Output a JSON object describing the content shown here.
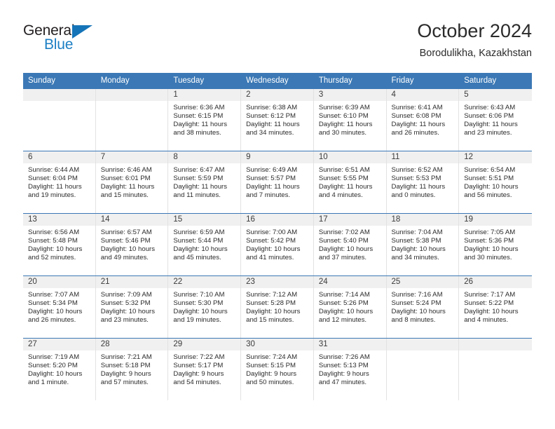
{
  "brand": {
    "name_part1": "General",
    "name_part2": "Blue",
    "triangle_color": "#1574b8",
    "blue_text_color": "#1c7fc4"
  },
  "header": {
    "title": "October 2024",
    "subtitle": "Borodulikha, Kazakhstan"
  },
  "theme": {
    "header_blue": "#3b78b5",
    "daynum_band": "#f0f0f0",
    "cell_border": "#e2e2e2",
    "text": "#2b2b2b"
  },
  "weekday_headers": [
    "Sunday",
    "Monday",
    "Tuesday",
    "Wednesday",
    "Thursday",
    "Friday",
    "Saturday"
  ],
  "weeks": [
    [
      {
        "day": "",
        "sunrise": "",
        "sunset": "",
        "daylight_1": "",
        "daylight_2": ""
      },
      {
        "day": "",
        "sunrise": "",
        "sunset": "",
        "daylight_1": "",
        "daylight_2": ""
      },
      {
        "day": "1",
        "sunrise": "Sunrise: 6:36 AM",
        "sunset": "Sunset: 6:15 PM",
        "daylight_1": "Daylight: 11 hours",
        "daylight_2": "and 38 minutes."
      },
      {
        "day": "2",
        "sunrise": "Sunrise: 6:38 AM",
        "sunset": "Sunset: 6:12 PM",
        "daylight_1": "Daylight: 11 hours",
        "daylight_2": "and 34 minutes."
      },
      {
        "day": "3",
        "sunrise": "Sunrise: 6:39 AM",
        "sunset": "Sunset: 6:10 PM",
        "daylight_1": "Daylight: 11 hours",
        "daylight_2": "and 30 minutes."
      },
      {
        "day": "4",
        "sunrise": "Sunrise: 6:41 AM",
        "sunset": "Sunset: 6:08 PM",
        "daylight_1": "Daylight: 11 hours",
        "daylight_2": "and 26 minutes."
      },
      {
        "day": "5",
        "sunrise": "Sunrise: 6:43 AM",
        "sunset": "Sunset: 6:06 PM",
        "daylight_1": "Daylight: 11 hours",
        "daylight_2": "and 23 minutes."
      }
    ],
    [
      {
        "day": "6",
        "sunrise": "Sunrise: 6:44 AM",
        "sunset": "Sunset: 6:04 PM",
        "daylight_1": "Daylight: 11 hours",
        "daylight_2": "and 19 minutes."
      },
      {
        "day": "7",
        "sunrise": "Sunrise: 6:46 AM",
        "sunset": "Sunset: 6:01 PM",
        "daylight_1": "Daylight: 11 hours",
        "daylight_2": "and 15 minutes."
      },
      {
        "day": "8",
        "sunrise": "Sunrise: 6:47 AM",
        "sunset": "Sunset: 5:59 PM",
        "daylight_1": "Daylight: 11 hours",
        "daylight_2": "and 11 minutes."
      },
      {
        "day": "9",
        "sunrise": "Sunrise: 6:49 AM",
        "sunset": "Sunset: 5:57 PM",
        "daylight_1": "Daylight: 11 hours",
        "daylight_2": "and 7 minutes."
      },
      {
        "day": "10",
        "sunrise": "Sunrise: 6:51 AM",
        "sunset": "Sunset: 5:55 PM",
        "daylight_1": "Daylight: 11 hours",
        "daylight_2": "and 4 minutes."
      },
      {
        "day": "11",
        "sunrise": "Sunrise: 6:52 AM",
        "sunset": "Sunset: 5:53 PM",
        "daylight_1": "Daylight: 11 hours",
        "daylight_2": "and 0 minutes."
      },
      {
        "day": "12",
        "sunrise": "Sunrise: 6:54 AM",
        "sunset": "Sunset: 5:51 PM",
        "daylight_1": "Daylight: 10 hours",
        "daylight_2": "and 56 minutes."
      }
    ],
    [
      {
        "day": "13",
        "sunrise": "Sunrise: 6:56 AM",
        "sunset": "Sunset: 5:48 PM",
        "daylight_1": "Daylight: 10 hours",
        "daylight_2": "and 52 minutes."
      },
      {
        "day": "14",
        "sunrise": "Sunrise: 6:57 AM",
        "sunset": "Sunset: 5:46 PM",
        "daylight_1": "Daylight: 10 hours",
        "daylight_2": "and 49 minutes."
      },
      {
        "day": "15",
        "sunrise": "Sunrise: 6:59 AM",
        "sunset": "Sunset: 5:44 PM",
        "daylight_1": "Daylight: 10 hours",
        "daylight_2": "and 45 minutes."
      },
      {
        "day": "16",
        "sunrise": "Sunrise: 7:00 AM",
        "sunset": "Sunset: 5:42 PM",
        "daylight_1": "Daylight: 10 hours",
        "daylight_2": "and 41 minutes."
      },
      {
        "day": "17",
        "sunrise": "Sunrise: 7:02 AM",
        "sunset": "Sunset: 5:40 PM",
        "daylight_1": "Daylight: 10 hours",
        "daylight_2": "and 37 minutes."
      },
      {
        "day": "18",
        "sunrise": "Sunrise: 7:04 AM",
        "sunset": "Sunset: 5:38 PM",
        "daylight_1": "Daylight: 10 hours",
        "daylight_2": "and 34 minutes."
      },
      {
        "day": "19",
        "sunrise": "Sunrise: 7:05 AM",
        "sunset": "Sunset: 5:36 PM",
        "daylight_1": "Daylight: 10 hours",
        "daylight_2": "and 30 minutes."
      }
    ],
    [
      {
        "day": "20",
        "sunrise": "Sunrise: 7:07 AM",
        "sunset": "Sunset: 5:34 PM",
        "daylight_1": "Daylight: 10 hours",
        "daylight_2": "and 26 minutes."
      },
      {
        "day": "21",
        "sunrise": "Sunrise: 7:09 AM",
        "sunset": "Sunset: 5:32 PM",
        "daylight_1": "Daylight: 10 hours",
        "daylight_2": "and 23 minutes."
      },
      {
        "day": "22",
        "sunrise": "Sunrise: 7:10 AM",
        "sunset": "Sunset: 5:30 PM",
        "daylight_1": "Daylight: 10 hours",
        "daylight_2": "and 19 minutes."
      },
      {
        "day": "23",
        "sunrise": "Sunrise: 7:12 AM",
        "sunset": "Sunset: 5:28 PM",
        "daylight_1": "Daylight: 10 hours",
        "daylight_2": "and 15 minutes."
      },
      {
        "day": "24",
        "sunrise": "Sunrise: 7:14 AM",
        "sunset": "Sunset: 5:26 PM",
        "daylight_1": "Daylight: 10 hours",
        "daylight_2": "and 12 minutes."
      },
      {
        "day": "25",
        "sunrise": "Sunrise: 7:16 AM",
        "sunset": "Sunset: 5:24 PM",
        "daylight_1": "Daylight: 10 hours",
        "daylight_2": "and 8 minutes."
      },
      {
        "day": "26",
        "sunrise": "Sunrise: 7:17 AM",
        "sunset": "Sunset: 5:22 PM",
        "daylight_1": "Daylight: 10 hours",
        "daylight_2": "and 4 minutes."
      }
    ],
    [
      {
        "day": "27",
        "sunrise": "Sunrise: 7:19 AM",
        "sunset": "Sunset: 5:20 PM",
        "daylight_1": "Daylight: 10 hours",
        "daylight_2": "and 1 minute."
      },
      {
        "day": "28",
        "sunrise": "Sunrise: 7:21 AM",
        "sunset": "Sunset: 5:18 PM",
        "daylight_1": "Daylight: 9 hours",
        "daylight_2": "and 57 minutes."
      },
      {
        "day": "29",
        "sunrise": "Sunrise: 7:22 AM",
        "sunset": "Sunset: 5:17 PM",
        "daylight_1": "Daylight: 9 hours",
        "daylight_2": "and 54 minutes."
      },
      {
        "day": "30",
        "sunrise": "Sunrise: 7:24 AM",
        "sunset": "Sunset: 5:15 PM",
        "daylight_1": "Daylight: 9 hours",
        "daylight_2": "and 50 minutes."
      },
      {
        "day": "31",
        "sunrise": "Sunrise: 7:26 AM",
        "sunset": "Sunset: 5:13 PM",
        "daylight_1": "Daylight: 9 hours",
        "daylight_2": "and 47 minutes."
      },
      {
        "day": "",
        "sunrise": "",
        "sunset": "",
        "daylight_1": "",
        "daylight_2": ""
      },
      {
        "day": "",
        "sunrise": "",
        "sunset": "",
        "daylight_1": "",
        "daylight_2": ""
      }
    ]
  ]
}
